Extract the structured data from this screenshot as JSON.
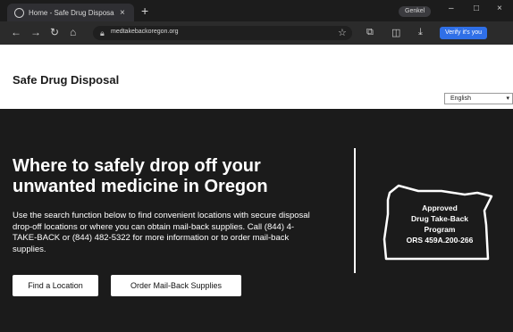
{
  "browser": {
    "tab_title": "Home - Safe Drug Disposal",
    "new_tab": "+",
    "close_tab": "×",
    "badge": "Genkel",
    "url": "medtakebackoregon.org",
    "verify": "Verify it's you",
    "window_minimize": "–",
    "window_maximize": "□",
    "window_close": "×"
  },
  "header": {
    "site_title": "Safe Drug Disposal"
  },
  "language": {
    "selected": "English"
  },
  "hero": {
    "heading": "Where to safely drop off your unwanted medicine in Oregon",
    "body": "Use the search function below to find convenient locations with secure disposal drop-off locations or where you can obtain mail-back supplies. Call (844) 4-TAKE-BACK or (844) 482-5322 for more information or to order mail-back supplies.",
    "buttons": {
      "find": "Find a Location",
      "order": "Order Mail-Back Supplies"
    }
  },
  "badge_map": {
    "line1": "Approved",
    "line2": "Drug Take-Back",
    "line3": "Program",
    "line4": "ORS 459A.200-266"
  },
  "colors": {
    "hero_bg": "#1b1b1b",
    "chrome_bg": "#1c1c1c",
    "accent": "#2f6fe7"
  },
  "icons": {
    "back": "arrow-left-icon",
    "forward": "arrow-right-icon",
    "reload": "reload-icon",
    "home": "home-icon",
    "lock": "lock-icon",
    "star": "star-icon",
    "extensions": "puzzle-icon",
    "split": "split-screen-icon",
    "downloads": "download-icon"
  }
}
